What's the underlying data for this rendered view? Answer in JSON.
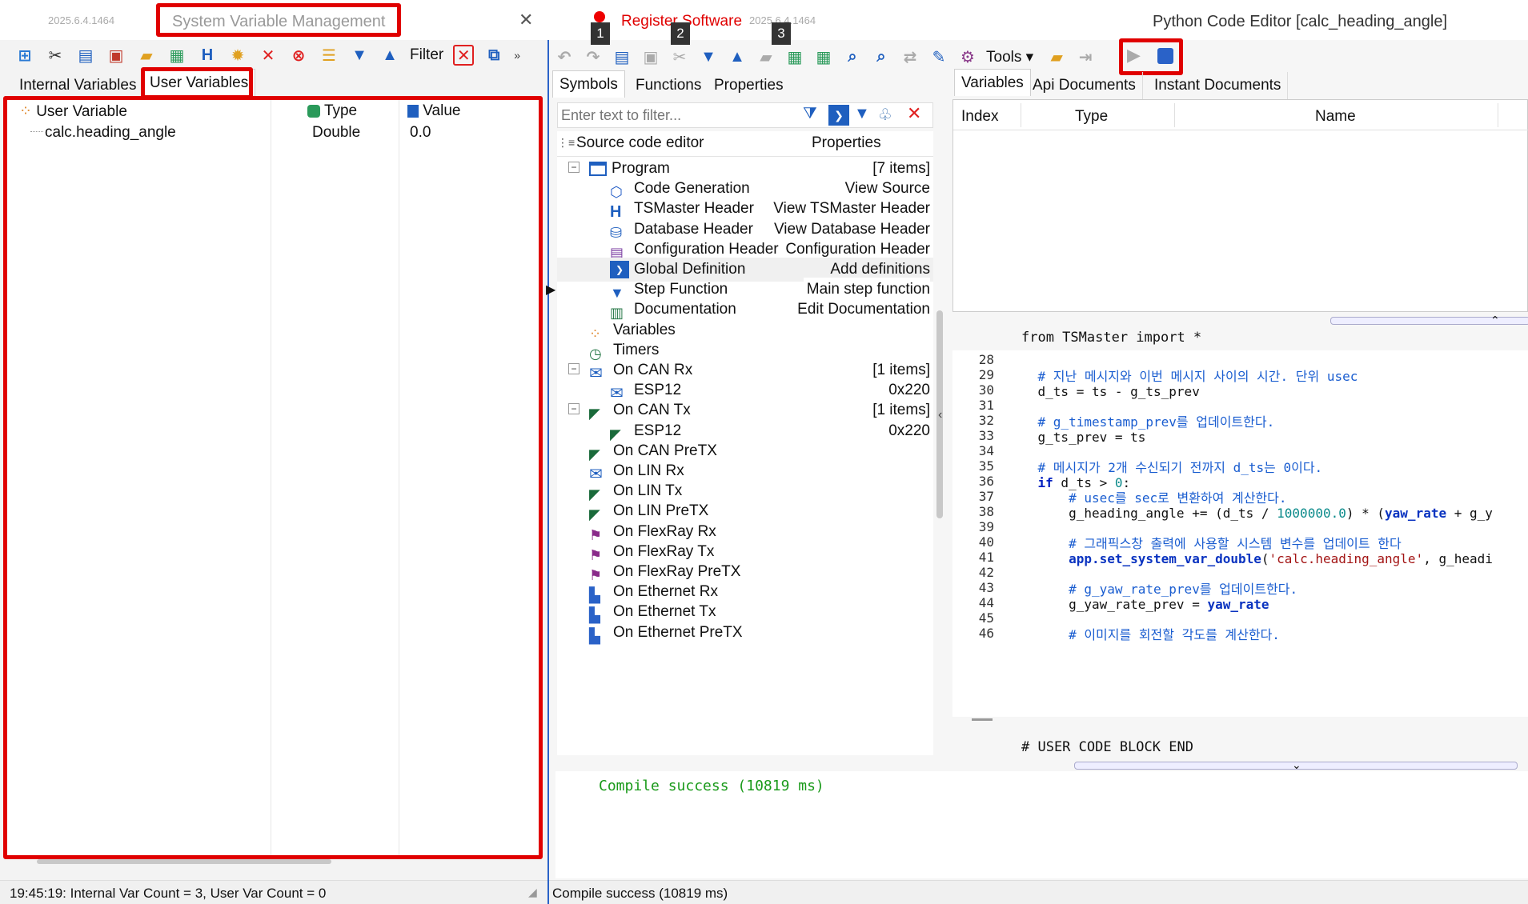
{
  "left_panel": {
    "version": "2025.6.4.1464",
    "title": "System Variable Management",
    "filter_label": "Filter",
    "tabs": [
      "Internal Variables",
      "User Variables"
    ],
    "columns": {
      "name": "User Variable",
      "type": "Type",
      "value": "Value"
    },
    "rows": [
      {
        "name": "calc.heading_angle",
        "type": "Double",
        "value": "0.0"
      }
    ],
    "status": "19:45:19: Internal Var Count = 3, User Var Count = 0"
  },
  "right_panel": {
    "register_label": "Register Software",
    "version": "2025.6.4.1464",
    "title": "Python Code Editor [calc_heading_angle]",
    "badges": [
      "1",
      "2",
      "3"
    ],
    "tools_label": "Tools",
    "left_tabs": [
      "Symbols",
      "Functions",
      "Properties"
    ],
    "filter_placeholder": "Enter text to filter...",
    "tree_header": {
      "col1": "Source code editor",
      "col2": "Properties"
    },
    "tree": [
      {
        "label": "Program",
        "prop": "[7 items]",
        "level": 0,
        "toggle": "−",
        "icon": "window-icon"
      },
      {
        "label": "Code Generation",
        "prop": "View Source",
        "level": 1,
        "icon": "code-gen-icon"
      },
      {
        "label": "TSMaster Header",
        "prop": "View TSMaster Header",
        "level": 1,
        "icon": "h-icon"
      },
      {
        "label": "Database Header",
        "prop": "View Database Header",
        "level": 1,
        "icon": "database-icon"
      },
      {
        "label": "Configuration Header",
        "prop": "Configuration Header",
        "level": 1,
        "icon": "config-icon"
      },
      {
        "label": "Global Definition",
        "prop": "Add definitions",
        "level": 1,
        "icon": "terminal-icon"
      },
      {
        "label": "Step Function",
        "prop": "Main step function",
        "level": 1,
        "icon": "triangle-icon"
      },
      {
        "label": "Documentation",
        "prop": "Edit Documentation",
        "level": 1,
        "icon": "book-icon"
      },
      {
        "label": "Variables",
        "prop": "",
        "level": 0,
        "icon": "variables-icon"
      },
      {
        "label": "Timers",
        "prop": "",
        "level": 0,
        "icon": "clock-icon"
      },
      {
        "label": "On CAN Rx",
        "prop": "[1 items]",
        "level": 0,
        "toggle": "−",
        "icon": "envelope-icon"
      },
      {
        "label": "ESP12",
        "prop": "0x220",
        "level": 1,
        "icon": "envelope-icon"
      },
      {
        "label": "On CAN Tx",
        "prop": "[1 items]",
        "level": 0,
        "toggle": "−",
        "icon": "send-icon"
      },
      {
        "label": "ESP12",
        "prop": "0x220",
        "level": 1,
        "icon": "send-icon"
      },
      {
        "label": "On CAN PreTX",
        "prop": "",
        "level": 0,
        "icon": "send-icon"
      },
      {
        "label": "On LIN Rx",
        "prop": "",
        "level": 0,
        "icon": "envelope-icon"
      },
      {
        "label": "On LIN Tx",
        "prop": "",
        "level": 0,
        "icon": "send-icon"
      },
      {
        "label": "On LIN PreTX",
        "prop": "",
        "level": 0,
        "icon": "send-icon"
      },
      {
        "label": "On FlexRay Rx",
        "prop": "",
        "level": 0,
        "icon": "flexray-icon"
      },
      {
        "label": "On FlexRay Tx",
        "prop": "",
        "level": 0,
        "icon": "flexray-icon"
      },
      {
        "label": "On FlexRay PreTX",
        "prop": "",
        "level": 0,
        "icon": "flexray-icon"
      },
      {
        "label": "On Ethernet Rx",
        "prop": "",
        "level": 0,
        "icon": "ethernet-icon"
      },
      {
        "label": "On Ethernet Tx",
        "prop": "",
        "level": 0,
        "icon": "ethernet-icon"
      },
      {
        "label": "On Ethernet PreTX",
        "prop": "",
        "level": 0,
        "icon": "ethernet-icon"
      }
    ],
    "right_tabs": [
      "Variables",
      "Api Documents",
      "Instant Documents"
    ],
    "var_columns": [
      "Index",
      "Type",
      "Name"
    ],
    "code_header": "from TSMaster import *",
    "code_lines": [
      {
        "n": "28",
        "t": ""
      },
      {
        "n": "29",
        "t": "    # 지난 메시지와 이번 메시지 사이의 시간. 단위 usec",
        "c": "cmt"
      },
      {
        "n": "30",
        "t": "    d_ts = ts - g_ts_prev"
      },
      {
        "n": "31",
        "t": ""
      },
      {
        "n": "32",
        "t": "    # g_timestamp_prev를 업데이트한다.",
        "c": "cmt"
      },
      {
        "n": "33",
        "t": "    g_ts_prev = ts"
      },
      {
        "n": "34",
        "t": ""
      },
      {
        "n": "35",
        "t": "    # 메시지가 2개 수신되기 전까지 d_ts는 0이다.",
        "c": "cmt"
      },
      {
        "n": "36",
        "t": "    if d_ts > 0:"
      },
      {
        "n": "37",
        "t": "        # usec를 sec로 변환하여 계산한다.",
        "c": "cmt"
      },
      {
        "n": "38",
        "t": "        g_heading_angle += (d_ts / 1000000.0) * (yaw_rate + g_y"
      },
      {
        "n": "39",
        "t": ""
      },
      {
        "n": "40",
        "t": "        # 그래픽스창 출력에 사용할 시스템 변수를 업데이트 한다",
        "c": "cmt"
      },
      {
        "n": "41",
        "t": "        app.set_system_var_double('calc.heading_angle', g_headi"
      },
      {
        "n": "42",
        "t": ""
      },
      {
        "n": "43",
        "t": "        # g_yaw_rate_prev를 업데이트한다.",
        "c": "cmt"
      },
      {
        "n": "44",
        "t": "        g_yaw_rate_prev = yaw_rate"
      },
      {
        "n": "45",
        "t": ""
      },
      {
        "n": "46",
        "t": "        # 이미지를 회전할 각도를 계산한다.",
        "c": "cmt"
      }
    ],
    "code_footer": "# USER CODE BLOCK END",
    "output": "Compile success (10819 ms)",
    "status": "Compile success (10819 ms)"
  }
}
